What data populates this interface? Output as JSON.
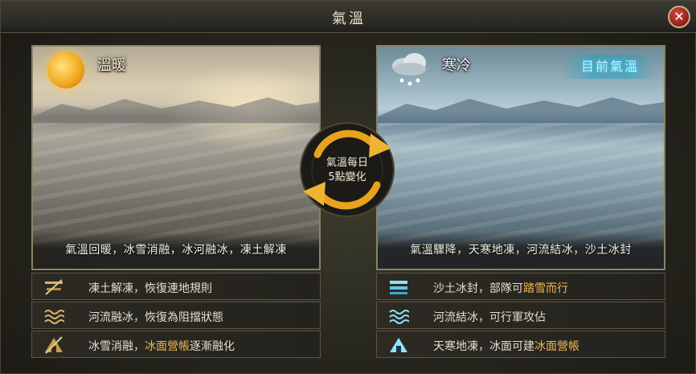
{
  "window": {
    "title": "氣溫"
  },
  "warm": {
    "title": "溫暖",
    "caption": "氣溫回暖，冰雪消融，冰河融冰，凍土解凍",
    "effects": [
      {
        "icon": "thaw-ground-icon",
        "text": "凍土解凍，恢復連地規則",
        "highlight": "",
        "rest": ""
      },
      {
        "icon": "river-melt-icon",
        "text": "河流融冰，恢復為阻擋狀態",
        "highlight": "",
        "rest": ""
      },
      {
        "icon": "melting-tent-icon",
        "text": "冰雪消融，",
        "highlight": "冰面營帳",
        "rest": "逐漸融化"
      }
    ]
  },
  "cold": {
    "title": "寒冷",
    "badge": "目前氣溫",
    "caption": "氣溫驟降，天寒地凍，河流結冰，沙土冰封",
    "effects": [
      {
        "icon": "frozen-sand-icon",
        "text": "沙土冰封，部隊可",
        "highlight": "踏雪而行",
        "rest": ""
      },
      {
        "icon": "frozen-river-icon",
        "text": "河流結冰，可行軍攻佔",
        "highlight": "",
        "rest": ""
      },
      {
        "icon": "ice-tent-icon",
        "text": "天寒地凍，冰面可建",
        "highlight": "冰面營帳",
        "rest": ""
      }
    ]
  },
  "center": {
    "line1": "氣溫每日",
    "line2": "5點變化"
  },
  "colors": {
    "highlight": "#f0b652",
    "badge": "#bff4ff",
    "arrow": "#e8a21e"
  }
}
